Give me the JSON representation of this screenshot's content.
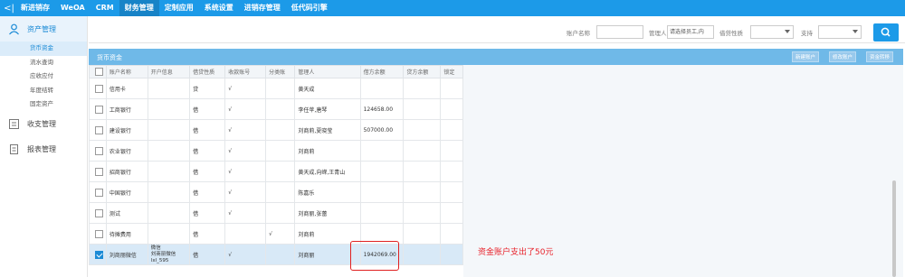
{
  "topnav": {
    "items": [
      "新进销存",
      "WeOA",
      "CRM",
      "财务管理",
      "定制应用",
      "系统设置",
      "进销存管理",
      "低代码引擎"
    ],
    "active_index": 3
  },
  "sidebar": {
    "groups": [
      {
        "label": "资产管理",
        "icon": "asset-icon"
      },
      {
        "label": "收支管理",
        "icon": "ledger-icon"
      },
      {
        "label": "报表管理",
        "icon": "report-icon"
      }
    ],
    "subitems": [
      "货币资金",
      "流水查询",
      "应收应付",
      "年度结转",
      "固定资产"
    ],
    "active_subitem_index": 0
  },
  "filters": {
    "account_name_label": "账户名称",
    "account_name_value": "",
    "manager_label": "管理人",
    "manager_placeholder": "请选择员工,内",
    "nature_label": "借贷性质",
    "nature_value": "",
    "support_label": "支持",
    "support_value": ""
  },
  "panel": {
    "title": "货币资金",
    "buttons": [
      "新建账户",
      "修改账户",
      "资金转移"
    ]
  },
  "table": {
    "headers": [
      "账户名称",
      "开户信息",
      "借贷性质",
      "收款账号",
      "分类账",
      "管理人",
      "借方余额",
      "贷方余额",
      "锁定"
    ],
    "rows": [
      {
        "name": "信用卡",
        "info": "",
        "nature": "贷",
        "receive": "√",
        "ledger": "",
        "manager": "黄天成",
        "debit": "",
        "credit": "",
        "lock": "",
        "checked": false
      },
      {
        "name": "工商银行",
        "info": "",
        "nature": "借",
        "receive": "√",
        "ledger": "",
        "manager": "李任苹,唐琴",
        "debit": "124658.00",
        "credit": "",
        "lock": "",
        "checked": false
      },
      {
        "name": "建设银行",
        "info": "",
        "nature": "借",
        "receive": "√",
        "ledger": "",
        "manager": "刘商莉,夏晓莹",
        "debit": "507000.00",
        "credit": "",
        "lock": "",
        "checked": false
      },
      {
        "name": "农业银行",
        "info": "",
        "nature": "借",
        "receive": "√",
        "ledger": "",
        "manager": "刘商莉",
        "debit": "",
        "credit": "",
        "lock": "",
        "checked": false
      },
      {
        "name": "招商银行",
        "info": "",
        "nature": "借",
        "receive": "√",
        "ledger": "",
        "manager": "黄天成,向嵘,王青山",
        "debit": "",
        "credit": "",
        "lock": "",
        "checked": false
      },
      {
        "name": "中国银行",
        "info": "",
        "nature": "借",
        "receive": "√",
        "ledger": "",
        "manager": "陈嘉乐",
        "debit": "",
        "credit": "",
        "lock": "",
        "checked": false
      },
      {
        "name": "测试",
        "info": "",
        "nature": "借",
        "receive": "√",
        "ledger": "",
        "manager": "刘商丽,张蕾",
        "debit": "",
        "credit": "",
        "lock": "",
        "checked": false
      },
      {
        "name": "待摊费用",
        "info": "",
        "nature": "借",
        "receive": "",
        "ledger": "√",
        "manager": "刘商莉",
        "debit": "",
        "credit": "",
        "lock": "",
        "checked": false
      },
      {
        "name": "刘商丽微信",
        "info_lines": [
          "微信",
          "刘商丽微信",
          "lxl_595"
        ],
        "nature": "借",
        "receive": "√",
        "ledger": "",
        "manager": "刘商丽",
        "debit": "1942069.00",
        "credit": "",
        "lock": "",
        "checked": true
      }
    ]
  },
  "annotation": "资金账户支出了50元",
  "colors": {
    "nav": "#1c9ae8",
    "panel_header": "#6fb9e8",
    "annotation": "#e8222b"
  }
}
